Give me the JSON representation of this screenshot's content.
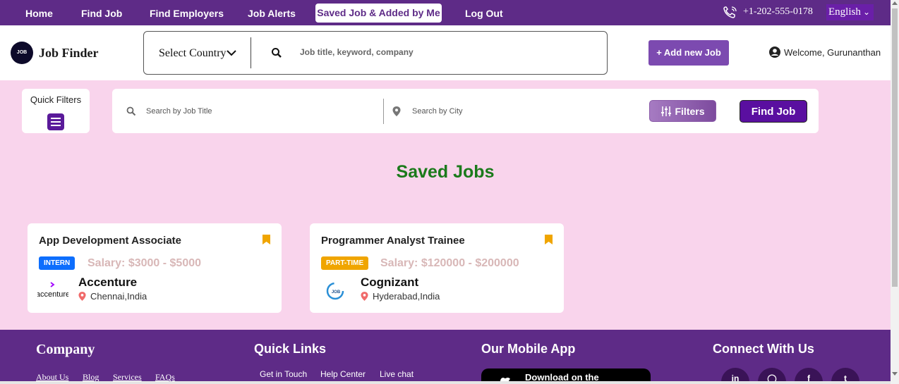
{
  "topnav": {
    "items": [
      "Home",
      "Find Job",
      "Find Employers",
      "Job Alerts"
    ],
    "active": "Saved Job & Added by Me",
    "logout": "Log Out",
    "phone": "+1-202-555-0178",
    "language": "English"
  },
  "header": {
    "logo_text": "JOB",
    "brand": "Job Finder",
    "country_select": "Select Country",
    "keyword_placeholder": "Job title, keyword, company",
    "add_job": "+ Add new Job",
    "welcome": "Welcome, Gurunanthan"
  },
  "filters": {
    "quick_filters": "Quick Filters",
    "title_placeholder": "Search by Job Title",
    "city_placeholder": "Search by City",
    "filters_button": "Filters",
    "find_button": "Find Job"
  },
  "page_title": "Saved Jobs",
  "jobs": [
    {
      "title": "App Development Associate",
      "type": "INTERN",
      "type_color": "#0d6efd",
      "salary": "Salary: $3000 - $5000",
      "company": "Accenture",
      "logo_text": "accenture",
      "location": "Chennai,India"
    },
    {
      "title": "Programmer Analyst Trainee",
      "type": "PART-TIME",
      "type_color": "#f0a500",
      "salary": "Salary: $120000 - $200000",
      "company": "Cognizant",
      "logo_text": "JOB",
      "location": "Hyderabad,India"
    }
  ],
  "footer": {
    "company_heading": "Company",
    "company_links": [
      "About Us",
      "Blog",
      "Services",
      "FAQs"
    ],
    "quick_heading": "Quick Links",
    "quick_links": [
      "Get in Touch",
      "Help Center",
      "Live chat"
    ],
    "app_heading": "Our Mobile App",
    "app_store": "Download on the",
    "connect_heading": "Connect With Us",
    "social_icons": [
      "linkedin-icon",
      "instagram-icon",
      "facebook-icon",
      "twitter-icon"
    ]
  },
  "colors": {
    "primary": "#5e2b87",
    "page_bg": "#f9d4ec",
    "title_green": "#1b7a1b",
    "bookmark": "#f0a500"
  }
}
